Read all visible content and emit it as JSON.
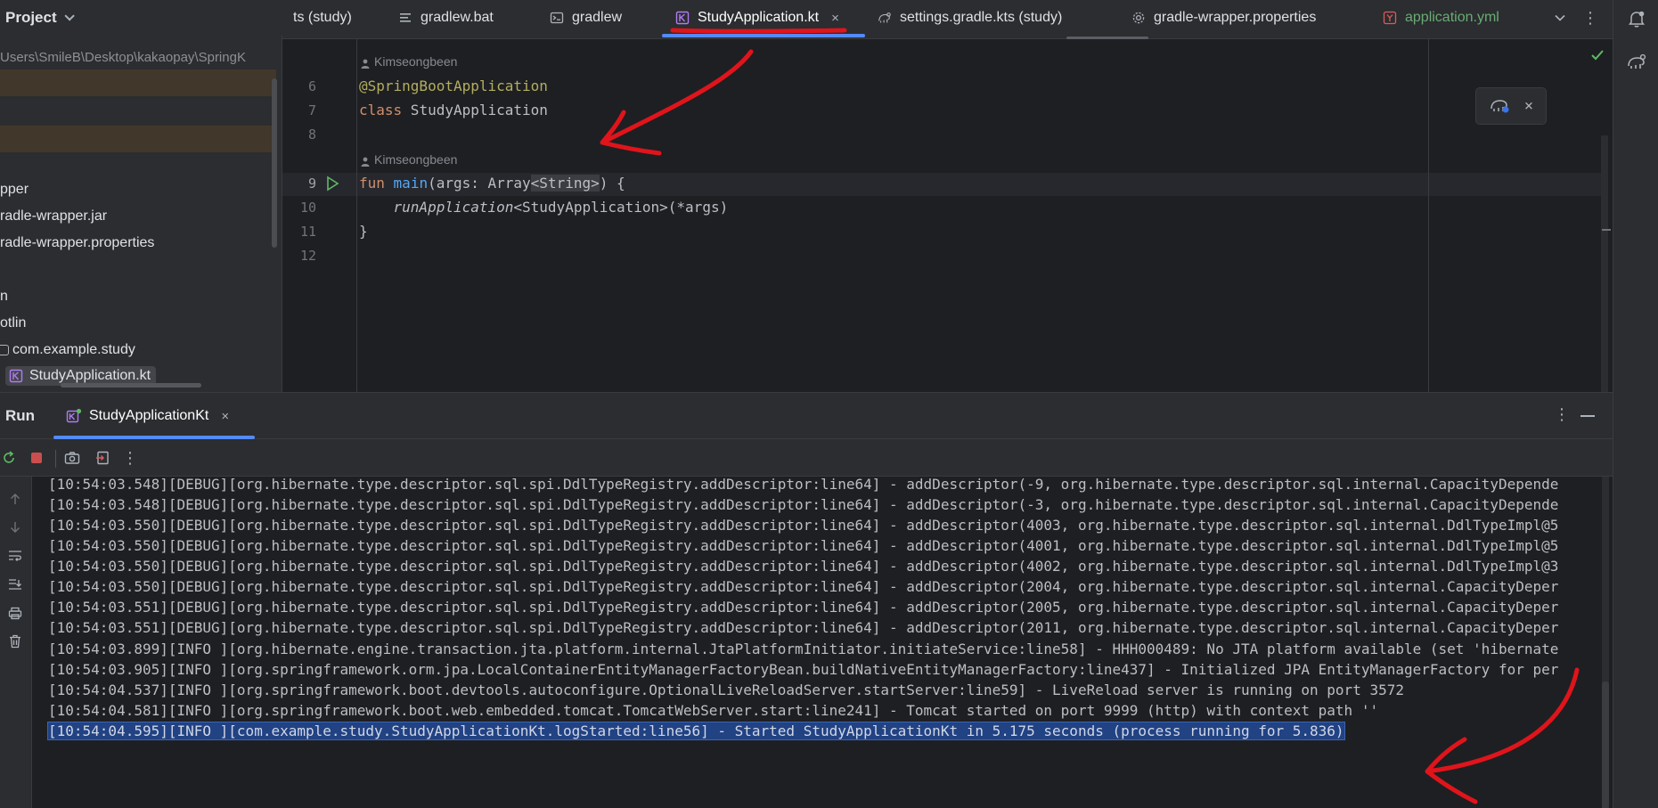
{
  "project_header": {
    "title": "Project"
  },
  "tabs": [
    {
      "label": "ts (study)",
      "icon": "gradle-kts-icon"
    },
    {
      "label": "gradlew.bat",
      "icon": "text-file-icon"
    },
    {
      "label": "gradlew",
      "icon": "terminal-file-icon"
    },
    {
      "label": "StudyApplication.kt",
      "icon": "kotlin-file-icon",
      "active": true
    },
    {
      "label": "settings.gradle.kts (study)",
      "icon": "gradle-elephant-icon"
    },
    {
      "label": "gradle-wrapper.properties",
      "icon": "gear-icon"
    },
    {
      "label": "application.yml",
      "icon": "yaml-file-icon",
      "color": "#6aab73"
    }
  ],
  "tab_close_glyph": "×",
  "project_tree": {
    "path": "Users\\SmileB\\Desktop\\kakaopay\\SpringK",
    "items": [
      {
        "label": "pper"
      },
      {
        "label": "radle-wrapper.jar"
      },
      {
        "label": "radle-wrapper.properties"
      },
      {
        "label": "n"
      },
      {
        "label": "otlin"
      },
      {
        "label": "com.example.study"
      },
      {
        "label": "StudyApplication.kt",
        "selected": true
      }
    ]
  },
  "editor": {
    "line_numbers": [
      "6",
      "7",
      "8",
      "9",
      "10",
      "11",
      "12"
    ],
    "author": "Kimseongbeen",
    "annotation": "@SpringBootApplication",
    "class_keyword": "class",
    "class_name": " StudyApplication",
    "fun_keyword": "fun",
    "fun_name": "main",
    "fun_params_a": "(args: Array",
    "fun_params_b": "<String>",
    "fun_params_c": ") {",
    "body_indent": "    ",
    "body_fn": "runApplication",
    "body_rest": "<StudyApplication>(*args)",
    "closing_brace": "}"
  },
  "run_panel": {
    "title": "Run",
    "tab_label": "StudyApplicationKt",
    "more_glyph": "⋮",
    "log_lines": [
      "[10:54:03.548][DEBUG][org.hibernate.type.descriptor.sql.spi.DdlTypeRegistry.addDescriptor:line64] - addDescriptor(-9, org.hibernate.type.descriptor.sql.internal.CapacityDepende",
      "[10:54:03.548][DEBUG][org.hibernate.type.descriptor.sql.spi.DdlTypeRegistry.addDescriptor:line64] - addDescriptor(-3, org.hibernate.type.descriptor.sql.internal.CapacityDepende",
      "[10:54:03.550][DEBUG][org.hibernate.type.descriptor.sql.spi.DdlTypeRegistry.addDescriptor:line64] - addDescriptor(4003, org.hibernate.type.descriptor.sql.internal.DdlTypeImpl@5",
      "[10:54:03.550][DEBUG][org.hibernate.type.descriptor.sql.spi.DdlTypeRegistry.addDescriptor:line64] - addDescriptor(4001, org.hibernate.type.descriptor.sql.internal.DdlTypeImpl@5",
      "[10:54:03.550][DEBUG][org.hibernate.type.descriptor.sql.spi.DdlTypeRegistry.addDescriptor:line64] - addDescriptor(4002, org.hibernate.type.descriptor.sql.internal.DdlTypeImpl@3",
      "[10:54:03.550][DEBUG][org.hibernate.type.descriptor.sql.spi.DdlTypeRegistry.addDescriptor:line64] - addDescriptor(2004, org.hibernate.type.descriptor.sql.internal.CapacityDeper",
      "[10:54:03.551][DEBUG][org.hibernate.type.descriptor.sql.spi.DdlTypeRegistry.addDescriptor:line64] - addDescriptor(2005, org.hibernate.type.descriptor.sql.internal.CapacityDeper",
      "[10:54:03.551][DEBUG][org.hibernate.type.descriptor.sql.spi.DdlTypeRegistry.addDescriptor:line64] - addDescriptor(2011, org.hibernate.type.descriptor.sql.internal.CapacityDeper",
      "[10:54:03.899][INFO ][org.hibernate.engine.transaction.jta.platform.internal.JtaPlatformInitiator.initiateService:line58] - HHH000489: No JTA platform available (set 'hibernate",
      "[10:54:03.905][INFO ][org.springframework.orm.jpa.LocalContainerEntityManagerFactoryBean.buildNativeEntityManagerFactory:line437] - Initialized JPA EntityManagerFactory for per",
      "[10:54:04.537][INFO ][org.springframework.boot.devtools.autoconfigure.OptionalLiveReloadServer.startServer:line59] - LiveReload server is running on port 3572",
      "[10:54:04.581][INFO ][org.springframework.boot.web.embedded.tomcat.TomcatWebServer.start:line241] - Tomcat started on port 9999 (http) with context path ''",
      "[10:54:04.595][INFO ][com.example.study.StudyApplicationKt.logStarted:line56] - Started StudyApplicationKt in 5.175 seconds (process running for 5.836)"
    ]
  },
  "colors": {
    "accent": "#548af7",
    "annotation_red": "#e0141b",
    "selection": "#214283",
    "success": "#5fb865"
  }
}
